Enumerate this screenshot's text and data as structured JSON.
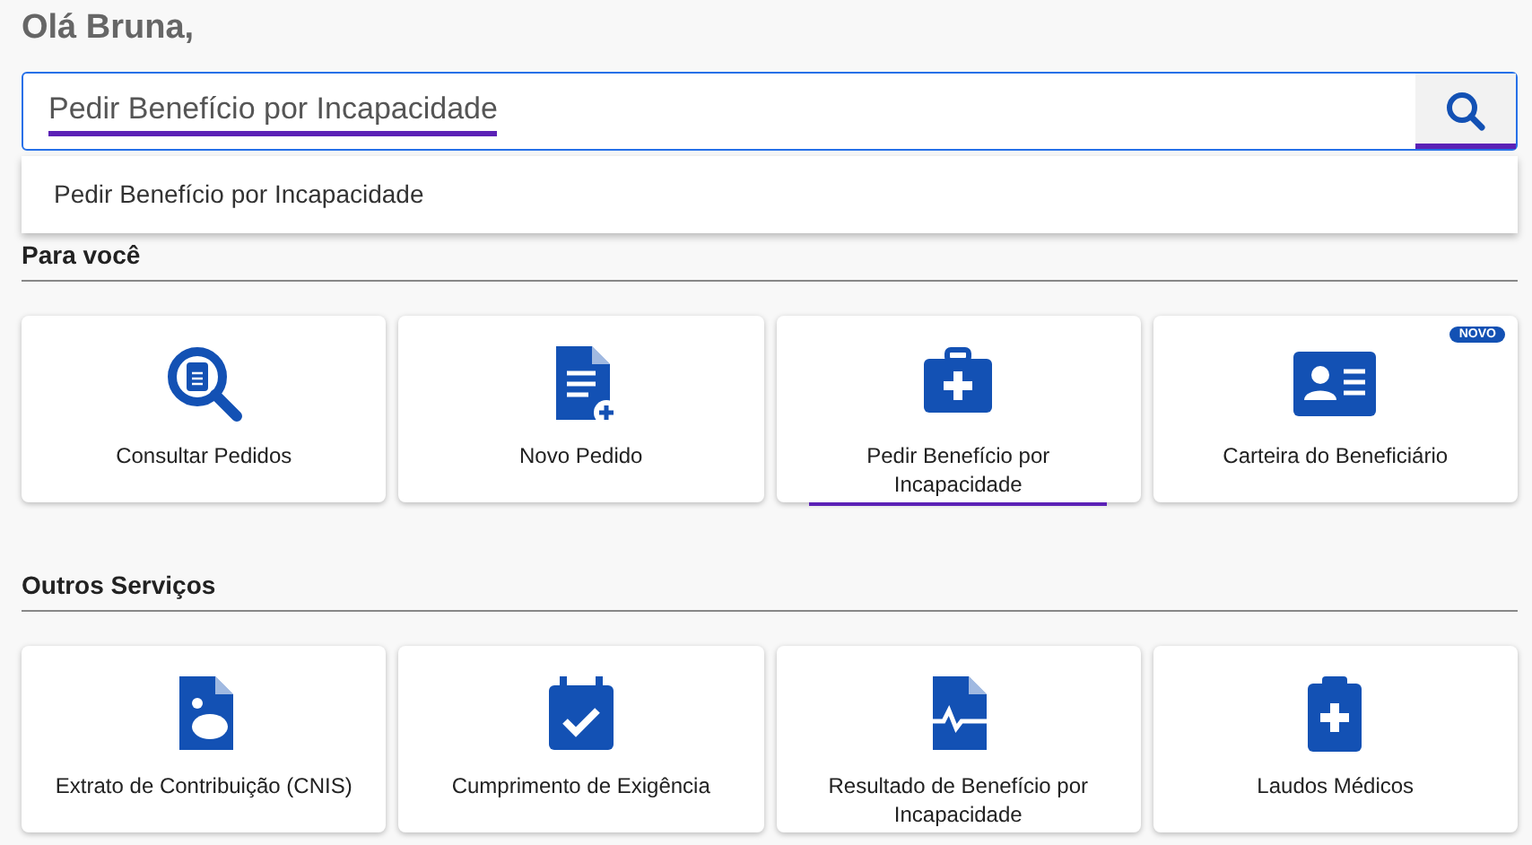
{
  "greeting": "Olá Bruna,",
  "search": {
    "value": "Pedir Benefício por Incapacidade",
    "highlighted": true,
    "button_highlighted": true,
    "suggestions": [
      "Pedir Benefício por Incapacidade"
    ]
  },
  "sections": [
    {
      "title": "Para você",
      "cards": [
        {
          "label": "Consultar Pedidos",
          "highlighted": false
        },
        {
          "label": "Novo Pedido",
          "highlighted": false
        },
        {
          "label": "Pedir Benefício por Incapacidade",
          "highlighted": true
        },
        {
          "label": "Carteira do Beneficiário",
          "highlighted": false,
          "badge": "NOVO"
        }
      ]
    },
    {
      "title": "Outros Serviços",
      "cards": [
        {
          "label": "Extrato de Contribuição (CNIS)",
          "highlighted": false
        },
        {
          "label": "Cumprimento de Exigência",
          "highlighted": false
        },
        {
          "label": "Resultado de Benefício por Incapacidade",
          "highlighted": false
        },
        {
          "label": "Laudos Médicos",
          "highlighted": false
        }
      ]
    }
  ]
}
